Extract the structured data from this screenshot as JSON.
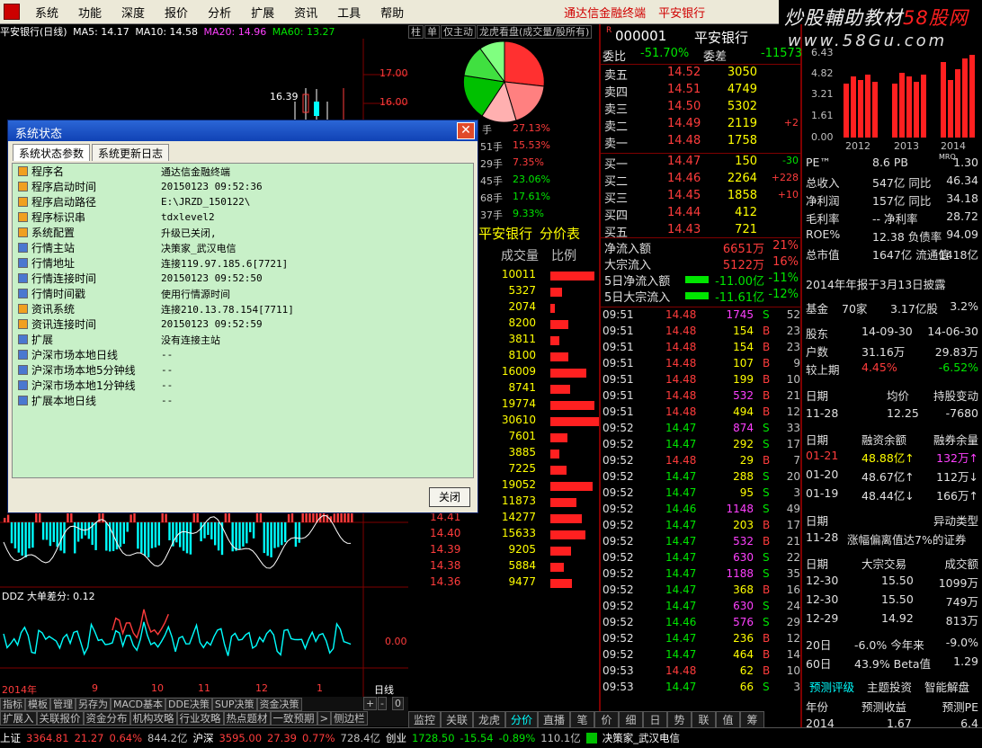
{
  "menu": {
    "items": [
      "系统",
      "功能",
      "深度",
      "报价",
      "分析",
      "扩展",
      "资讯",
      "工具",
      "帮助"
    ],
    "highlights": [
      "通达信金融终端",
      "平安银行"
    ]
  },
  "banner": {
    "line1_a": "炒股輔助教材",
    "line1_b": "58股网",
    "line2": "www.58Gu.com"
  },
  "chart": {
    "title": "平安银行(日线)",
    "ma5": "MA5: 14.17",
    "ma10": "MA10: 14.58",
    "ma20": "MA20: 14.96",
    "ma60": "MA60: 13.27",
    "y1": "17.00",
    "y2": "16.00",
    "peak": "16.39",
    "ddz_label": "DDZ 大单差分: 0.12",
    "ddz_zero": "0.00",
    "x_labels": [
      "2014年",
      "9",
      "10",
      "11",
      "12",
      "1"
    ],
    "period": "日线",
    "colors": {
      "up": "#ff3c3c",
      "down": "#00ffff"
    }
  },
  "dialog": {
    "title": "系统状态",
    "tab1": "系统状态参数",
    "tab2": "系统更新日志",
    "close": "关闭",
    "rows": [
      {
        "k": "程序名",
        "v": "通达信金融终端",
        "icon": "orange"
      },
      {
        "k": "程序启动时间",
        "v": "20150123 09:52:36",
        "icon": "orange"
      },
      {
        "k": "程序启动路径",
        "v": "E:\\JRZD_150122\\",
        "icon": "orange"
      },
      {
        "k": "程序标识串",
        "v": "tdxlevel2",
        "icon": "orange"
      },
      {
        "k": "系统配置",
        "v": "升级已关闭,",
        "icon": "orange"
      },
      {
        "k": "行情主站",
        "v": "决策家_武汉电信",
        "icon": "blue"
      },
      {
        "k": "行情地址",
        "v": "连接119.97.185.6[7721]",
        "icon": "blue"
      },
      {
        "k": "行情连接时间",
        "v": "20150123 09:52:50",
        "icon": "blue"
      },
      {
        "k": "行情时间戳",
        "v": "使用行情源时间",
        "icon": "blue"
      },
      {
        "k": "资讯系统",
        "v": "连接210.13.78.154[7711]",
        "icon": "orange"
      },
      {
        "k": "资讯连接时间",
        "v": "20150123 09:52:59",
        "icon": "orange"
      },
      {
        "k": "扩展",
        "v": "没有连接主站",
        "icon": "blue"
      },
      {
        "k": "沪深市场本地日线",
        "v": "--",
        "icon": "blue"
      },
      {
        "k": "沪深市场本地5分钟线",
        "v": "--",
        "icon": "blue"
      },
      {
        "k": "沪深市场本地1分钟线",
        "v": "--",
        "icon": "blue"
      },
      {
        "k": "扩展本地日线",
        "v": "--",
        "icon": "blue"
      }
    ]
  },
  "pie_panel": {
    "tabs": [
      "柱",
      "单",
      "仅主动",
      "龙虎看盘(成交量/股所有)"
    ],
    "rows": [
      {
        "a": "手",
        "b": "27.13%"
      },
      {
        "a": "51手",
        "b": "15.53%"
      },
      {
        "a": "29手",
        "b": "7.35%"
      },
      {
        "a": "45手",
        "b": "23.06%"
      },
      {
        "a": "68手",
        "b": "17.61%"
      },
      {
        "a": "37手",
        "b": "9.33%"
      }
    ],
    "stock": "平安银行",
    "title2": "分价表",
    "col_vol": "成交量",
    "col_ratio": "比例"
  },
  "price_table": [
    {
      "p": "",
      "v": "10011",
      "w": 49
    },
    {
      "p": "",
      "v": "5327",
      "w": 13
    },
    {
      "p": "",
      "v": "2074",
      "w": 5
    },
    {
      "p": "",
      "v": "8200",
      "w": 20
    },
    {
      "p": "",
      "v": "3811",
      "w": 10
    },
    {
      "p": "",
      "v": "8100",
      "w": 20
    },
    {
      "p": "",
      "v": "16009",
      "w": 40
    },
    {
      "p": "",
      "v": "8741",
      "w": 22
    },
    {
      "p": "",
      "v": "19774",
      "w": 49
    },
    {
      "p": "",
      "v": "30610",
      "w": 54
    },
    {
      "p": "",
      "v": "7601",
      "w": 19
    },
    {
      "p": "",
      "v": "3885",
      "w": 10
    },
    {
      "p": "",
      "v": "7225",
      "w": 18
    },
    {
      "p": "",
      "v": "19052",
      "w": 47
    },
    {
      "p": "",
      "v": "11873",
      "w": 29
    },
    {
      "p": "14.41",
      "v": "14277",
      "w": 35
    },
    {
      "p": "14.40",
      "v": "15633",
      "w": 39
    },
    {
      "p": "14.39",
      "v": "9205",
      "w": 23
    },
    {
      "p": "14.38",
      "v": "5884",
      "w": 15
    },
    {
      "p": "14.36",
      "v": "9477",
      "w": 24
    }
  ],
  "quote": {
    "code": "000001",
    "name": "平安银行",
    "weibi_label": "委比",
    "weibi": "-51.70%",
    "weicha_label": "委差",
    "weicha": "-11573",
    "asks": [
      {
        "l": "卖五",
        "p": "14.52",
        "v": "3050",
        "c": ""
      },
      {
        "l": "卖四",
        "p": "14.51",
        "v": "4749",
        "c": ""
      },
      {
        "l": "卖三",
        "p": "14.50",
        "v": "5302",
        "c": ""
      },
      {
        "l": "卖二",
        "p": "14.49",
        "v": "2119",
        "c": "+2"
      },
      {
        "l": "卖一",
        "p": "14.48",
        "v": "1758",
        "c": ""
      }
    ],
    "bids": [
      {
        "l": "买一",
        "p": "14.47",
        "v": "150",
        "c": "-30"
      },
      {
        "l": "买二",
        "p": "14.46",
        "v": "2264",
        "c": "+228"
      },
      {
        "l": "买三",
        "p": "14.45",
        "v": "1858",
        "c": "+10"
      },
      {
        "l": "买四",
        "p": "14.44",
        "v": "412",
        "c": ""
      },
      {
        "l": "买五",
        "p": "14.43",
        "v": "721",
        "c": ""
      }
    ],
    "flows": [
      {
        "l": "净流入额",
        "v": "6651万",
        "pct": "21%",
        "color": "#ff3c3c"
      },
      {
        "l": "大宗流入",
        "v": "5122万",
        "pct": "16%",
        "color": "#ff3c3c"
      },
      {
        "l": "5日净流入额",
        "v": "-11.00亿",
        "pct": "-11%",
        "color": "#00e600"
      },
      {
        "l": "5日大宗流入",
        "v": "-11.61亿",
        "pct": "-12%",
        "color": "#00e600"
      }
    ]
  },
  "ticks": [
    {
      "t": "09:51",
      "p": "14.48",
      "v": "1745",
      "bs": "S",
      "n": "52"
    },
    {
      "t": "09:51",
      "p": "14.48",
      "v": "154",
      "bs": "B",
      "n": "23"
    },
    {
      "t": "09:51",
      "p": "14.48",
      "v": "154",
      "bs": "B",
      "n": "23"
    },
    {
      "t": "09:51",
      "p": "14.48",
      "v": "107",
      "bs": "B",
      "n": "9"
    },
    {
      "t": "09:51",
      "p": "14.48",
      "v": "199",
      "bs": "B",
      "n": "10"
    },
    {
      "t": "09:51",
      "p": "14.48",
      "v": "532",
      "bs": "B",
      "n": "21"
    },
    {
      "t": "09:51",
      "p": "14.48",
      "v": "494",
      "bs": "B",
      "n": "12"
    },
    {
      "t": "09:52",
      "p": "14.47",
      "v": "874",
      "bs": "S",
      "n": "33"
    },
    {
      "t": "09:52",
      "p": "14.47",
      "v": "292",
      "bs": "S",
      "n": "17"
    },
    {
      "t": "09:52",
      "p": "14.48",
      "v": "29",
      "bs": "B",
      "n": "7"
    },
    {
      "t": "09:52",
      "p": "14.47",
      "v": "288",
      "bs": "S",
      "n": "20"
    },
    {
      "t": "09:52",
      "p": "14.47",
      "v": "95",
      "bs": "S",
      "n": "3"
    },
    {
      "t": "09:52",
      "p": "14.46",
      "v": "1148",
      "bs": "S",
      "n": "49"
    },
    {
      "t": "09:52",
      "p": "14.47",
      "v": "203",
      "bs": "B",
      "n": "17"
    },
    {
      "t": "09:52",
      "p": "14.47",
      "v": "532",
      "bs": "B",
      "n": "21"
    },
    {
      "t": "09:52",
      "p": "14.47",
      "v": "630",
      "bs": "S",
      "n": "22"
    },
    {
      "t": "09:52",
      "p": "14.47",
      "v": "1188",
      "bs": "S",
      "n": "35"
    },
    {
      "t": "09:52",
      "p": "14.47",
      "v": "368",
      "bs": "B",
      "n": "16"
    },
    {
      "t": "09:52",
      "p": "14.47",
      "v": "630",
      "bs": "S",
      "n": "24"
    },
    {
      "t": "09:52",
      "p": "14.46",
      "v": "576",
      "bs": "S",
      "n": "29"
    },
    {
      "t": "09:52",
      "p": "14.47",
      "v": "236",
      "bs": "B",
      "n": "12"
    },
    {
      "t": "09:52",
      "p": "14.47",
      "v": "464",
      "bs": "B",
      "n": "14"
    },
    {
      "t": "09:53",
      "p": "14.48",
      "v": "62",
      "bs": "B",
      "n": "10"
    },
    {
      "t": "09:53",
      "p": "14.47",
      "v": "66",
      "bs": "S",
      "n": "3"
    }
  ],
  "f10": {
    "bars_ylabels": [
      "6.43",
      "4.82",
      "3.21",
      "1.61",
      "0.00"
    ],
    "bars_years": [
      "2012",
      "2013",
      "2014"
    ],
    "rows": [
      {
        "l": "PE™",
        "m": "8.6 PB",
        "mq": "MRQ",
        "r": "1.30"
      },
      {
        "l": "总收入",
        "m": "547亿 同比",
        "r": "46.34"
      },
      {
        "l": "净利润",
        "m": "157亿 同比",
        "r": "34.18"
      },
      {
        "l": "毛利率",
        "m": "-- 净利率",
        "r": "28.72"
      },
      {
        "l": "ROE%",
        "m": "12.38 负债率",
        "r": "94.09"
      },
      {
        "l": "总市值",
        "m": "1647亿 流通值",
        "r": "1418亿"
      }
    ],
    "report": "2014年年报于3月13日披露",
    "fund": {
      "a": "基金",
      "b": "70家",
      "c": "3.17亿股",
      "d": "3.2%"
    },
    "holders": [
      {
        "a": "股东",
        "b": "14-09-30",
        "c": "14-06-30"
      },
      {
        "a": "户数",
        "b": "31.16万",
        "c": "29.83万"
      },
      {
        "a": "较上期",
        "b": "4.45%",
        "c": "-6.52%"
      }
    ],
    "holdchange": {
      "h1": "日期",
      "h2": "均价",
      "h3": "持股变动",
      "d": "11-28",
      "p": "12.25",
      "c": "-7680"
    },
    "margin_head": {
      "h1": "日期",
      "h2": "融资余额",
      "h3": "融券余量"
    },
    "margin": [
      {
        "d": "01-21",
        "a": "48.88亿↑",
        "b": "132万↑"
      },
      {
        "d": "01-20",
        "a": "48.67亿↑",
        "b": "112万↓"
      },
      {
        "d": "01-19",
        "a": "48.44亿↓",
        "b": "166万↑"
      }
    ],
    "abnormal_head": {
      "h1": "日期",
      "h2": "异动类型"
    },
    "abnormal": {
      "d": "11-28",
      "t": "涨幅偏离值达7%的证券"
    },
    "block_head": {
      "h1": "日期",
      "h2": "大宗交易",
      "h3": "成交额"
    },
    "block": [
      {
        "d": "12-30",
        "p": "15.50",
        "a": "1099万"
      },
      {
        "d": "12-30",
        "p": "15.50",
        "a": "749万"
      },
      {
        "d": "12-29",
        "p": "14.92",
        "a": "813万"
      }
    ],
    "perf": [
      {
        "a": "20日",
        "b": "-6.0% 今年来",
        "c": "-9.0%"
      },
      {
        "a": "60日",
        "b": "43.9% Beta值",
        "c": "1.29"
      }
    ],
    "eval_tabs": [
      "预测评级",
      "主题投资",
      "智能解盘"
    ],
    "forecast_head": {
      "h1": "年份",
      "h2": "预测收益",
      "h3": "预测PE"
    },
    "forecast": {
      "y": "2014",
      "e": "1.67",
      "pe": "6.4"
    }
  },
  "bottom": {
    "tabs1": [
      "指标",
      "模板",
      "管理",
      "另存为",
      "MACD基本",
      "DDE决策",
      "SUP决策",
      "资金决策"
    ],
    "tabs1_right": [
      "+",
      "-",
      "0"
    ],
    "tabs2": [
      "扩展入",
      "关联报价",
      "资金分布",
      "机构攻略",
      "行业攻略",
      "热点题材",
      "一致预期"
    ],
    "tabs2_arrow": ">",
    "tabs2_side": "侧边栏",
    "tabs3": [
      "监控",
      "关联",
      "龙虎",
      "分价",
      "直播",
      "笔",
      "价",
      "细",
      "日",
      "势",
      "联",
      "值",
      "筹"
    ],
    "status": {
      "sh": "上证",
      "sh_v": "3364.81",
      "sh_c": "21.27",
      "sh_p": "0.64%",
      "sh_a": "844.2亿",
      "sz": "沪深",
      "sz_v": "3595.00",
      "sz_c": "27.39",
      "sz_p": "0.77%",
      "sz_a": "728.4亿",
      "cy": "创业",
      "cy_v": "1728.50",
      "cy_c": "-15.54",
      "cy_p": "-0.89%",
      "cy_a": "110.1亿",
      "server": "决策家_武汉电信"
    }
  }
}
